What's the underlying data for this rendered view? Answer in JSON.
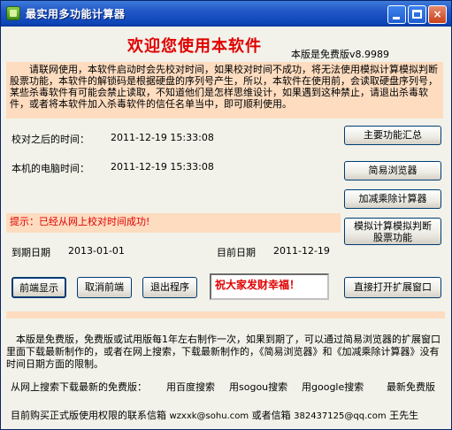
{
  "window": {
    "title": "最实用多功能计算器",
    "min_label": "",
    "max_label": "",
    "close_label": "×"
  },
  "header": {
    "welcome": "欢迎您使用本软件",
    "version": "本版是免费版v8.9989"
  },
  "notice": "请联网使用，本软件启动时会先校对时间，如果校对时间不成功，将无法使用模拟计算模拟判断股票功能，本软件的解锁码是根据硬盘的序列号产生，所以，本软件在使用前，会读取硬盘序列号，某些杀毒软件有可能会禁止读取，不知道他们是怎样思维设计，如果遇到这种禁止，请退出杀毒软件，或者将本软件加入杀毒软件的信任名单当中，即可顺利使用。",
  "time": {
    "calibrated_label": "校对之后的时间：",
    "calibrated_value": "2011-12-19 15:33:08",
    "local_label": "本机的电脑时间：",
    "local_value": "2011-12-19 15:33:08"
  },
  "hint": "提示：已经从网上校对时间成功!",
  "dates": {
    "expire_label": "到期日期",
    "expire_value": "2013-01-01",
    "current_label": "目前日期",
    "current_value": "2011-12-19"
  },
  "buttons": {
    "main_summary": "主要功能汇总",
    "simple_browser": "简易浏览器",
    "calculator": "加减乘除计算器",
    "simulate_line1": "模拟计算模拟判断",
    "simulate_line2": "股票功能",
    "show_front": "前端显示",
    "cancel_front": "取消前端",
    "exit": "退出程序",
    "open_extended": "直接打开扩展窗口"
  },
  "greeting": "祝大家发财幸福！",
  "info": "本版是免费版，免费版或试用版每1年左右制作一次，如果到期了，可以通过简易浏览器的扩展窗口里面下载最新制作的，或者在网上搜索，下载最新制作的，《简易浏览器》和《加减乘除计算器》没有时间日期方面的限制。",
  "links": {
    "search_label": "从网上搜索下载最新的免费版：",
    "baidu": "用百度搜索",
    "sogou": "用sogou搜索",
    "google": "用google搜索",
    "latest": "最新免费版"
  },
  "contact": {
    "prefix": "目前购买正式版使用权限的联系信箱",
    "email1": "wzxxk@sohu.com",
    "middle": "或者信箱",
    "email2": "382437125@qq.com",
    "name": "王先生"
  }
}
